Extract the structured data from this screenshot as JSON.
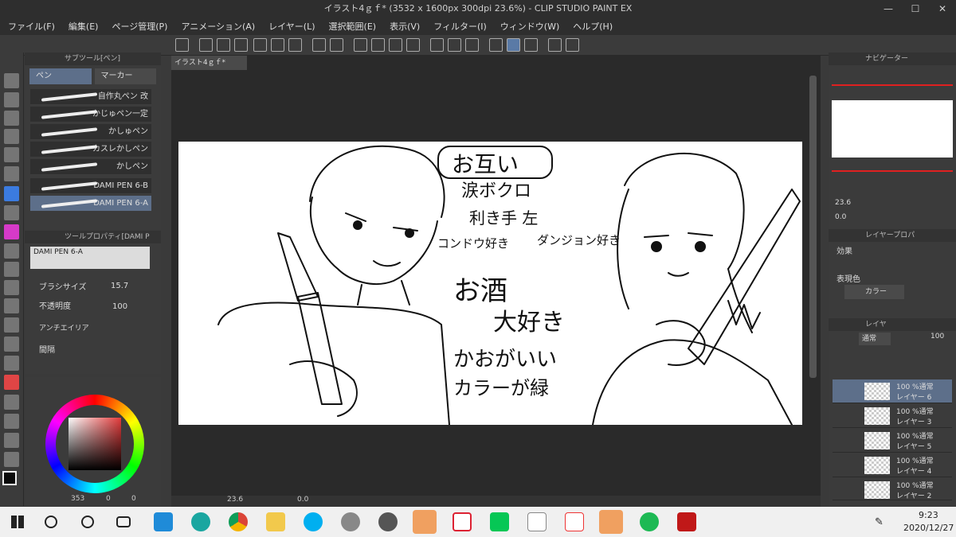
{
  "window": {
    "title": "イラスト4ｇｆ* (3532 x 1600px 300dpi 23.6%) - CLIP STUDIO PAINT EX"
  },
  "menu": [
    "ファイル(F)",
    "編集(E)",
    "ページ管理(P)",
    "アニメーション(A)",
    "レイヤー(L)",
    "選択範囲(E)",
    "表示(V)",
    "フィルター(I)",
    "ウィンドウ(W)",
    "ヘルプ(H)"
  ],
  "canvas_tab": "イラスト4ｇｆ*",
  "subtool": {
    "title": "サブツール[ペン]",
    "tabs": [
      "ペン",
      "マーカー"
    ],
    "brushes": [
      "自作丸ペン 改",
      "かじゅペン一定",
      "かしゅペン",
      "カスレかしペン",
      "かしペン",
      "DAMI PEN 6-B",
      "DAMI PEN 6-A"
    ]
  },
  "toolprop": {
    "title": "ツールプロパティ[DAMI P",
    "brush_name": "DAMI PEN 6-A",
    "brush_size_label": "ブラシサイズ",
    "brush_size": "15.7",
    "opacity_label": "不透明度",
    "opacity": "100",
    "antialias_label": "アンチエイリア",
    "spacing_label": "間隔"
  },
  "color": {
    "values": [
      "353",
      "0",
      "0"
    ],
    "fg": "#0a0a0a"
  },
  "canvas_text": {
    "bubble": "お互い",
    "line1": "涙ボクロ",
    "line2": "利き手 左",
    "line3": "コンドウ好き",
    "line4": "ダンジョン好き",
    "big1": "お酒",
    "big2": "大好き",
    "line5": "かおがいい",
    "line6": "カラーが緑"
  },
  "status": {
    "zoom": "23.6",
    "angle": "0.0"
  },
  "navigator": {
    "title": "ナビゲーター",
    "zoom": "23.6",
    "angle": "0.0"
  },
  "layerprop": {
    "title": "レイヤープロパ",
    "effect_label": "効果",
    "expr_label": "表現色",
    "expr_value": "カラー"
  },
  "layers": {
    "title": "レイヤ",
    "blend": "通常",
    "opacity": "100",
    "items": [
      {
        "line1": "100 %通常",
        "line2": "レイヤー 6"
      },
      {
        "line1": "100 %通常",
        "line2": "レイヤー 3"
      },
      {
        "line1": "100 %通常",
        "line2": "レイヤー 5"
      },
      {
        "line1": "100 %通常",
        "line2": "レイヤー 4"
      },
      {
        "line1": "100 %通常",
        "line2": "レイヤー 2"
      }
    ]
  },
  "taskbar": {
    "time": "9:23",
    "date": "2020/12/27"
  }
}
